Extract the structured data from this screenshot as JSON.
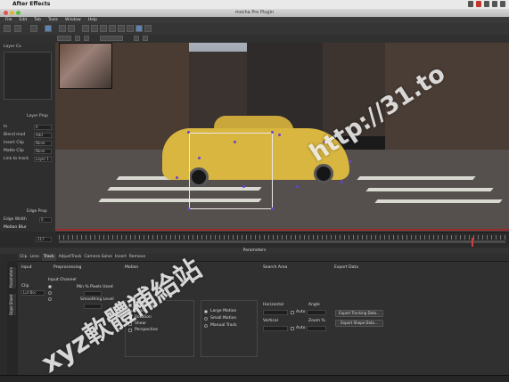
{
  "os_menubar": {
    "app": "After Effects"
  },
  "window": {
    "title": "mocha Pro Plugin"
  },
  "menu": [
    "File",
    "Edit",
    "Tab",
    "Tools",
    "Window",
    "Help"
  ],
  "left_panel": {
    "layer_header": "Layer Co",
    "layer_properties": "Layer Prop",
    "rows": [
      {
        "label": "In",
        "value": "0"
      },
      {
        "label": "Blend mod",
        "value": "Add"
      },
      {
        "label": "Insert Clip",
        "value": "None"
      },
      {
        "label": "Matte Clip",
        "value": "None"
      },
      {
        "label": "Link to track",
        "value": "Layer 1"
      }
    ],
    "edge_props": "Edge Prop",
    "edge_width_label": "Edge Width",
    "edge_width_value": "0",
    "motion_blur": "Motion Blur"
  },
  "timeline": {
    "frame_value": "117"
  },
  "params_header": "Parameters",
  "tabs": [
    "Clip",
    "Lens",
    "Track",
    "AdjustTrack",
    "Camera Solve",
    "Insert",
    "Remove"
  ],
  "active_tab": "Track",
  "side_tabs": [
    "Parameters",
    "Dope Sheet"
  ],
  "sections": {
    "input": "Input",
    "preprocessing": "Preprocessing",
    "motion": "Motion",
    "search_area": "Search Area",
    "export_data": "Export Data"
  },
  "clip_label": "Clip",
  "clip_value": "Lut Bor",
  "input_channel": "Input Channel",
  "min_pixels": "Min % Pixels Used",
  "smoothing": "Smoothing Level",
  "motion_options": [
    {
      "label": "Translation",
      "checked": true
    },
    {
      "label": "Scale",
      "checked": true
    },
    {
      "label": "Rotation",
      "checked": true
    },
    {
      "label": "Shear",
      "checked": false
    },
    {
      "label": "Perspective",
      "checked": false
    }
  ],
  "motion_types": [
    {
      "label": "Large Motion",
      "on": true
    },
    {
      "label": "Small Motion",
      "on": false
    },
    {
      "label": "Manual Track",
      "on": false
    }
  ],
  "search": {
    "horizontal": "Horizontal",
    "vertical": "Vertical",
    "angle": "Angle",
    "zoom": "Zoom %",
    "auto": "Auto"
  },
  "export_buttons": [
    "Export Tracking Data...",
    "Export Shape Data..."
  ],
  "watermarks": [
    "http://31.to",
    "xyz軟體補給站"
  ]
}
